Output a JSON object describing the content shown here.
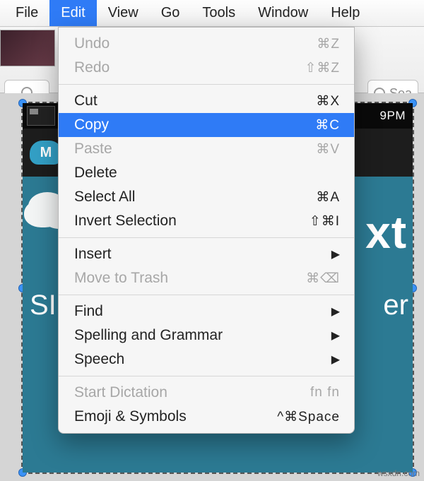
{
  "menubar": {
    "items": [
      "File",
      "Edit",
      "View",
      "Go",
      "Tools",
      "Window",
      "Help"
    ],
    "active_index": 1
  },
  "toolbar": {
    "search_placeholder": "Sea"
  },
  "dropdown": {
    "groups": [
      [
        {
          "label": "Undo",
          "shortcut": "⌘Z",
          "disabled": true
        },
        {
          "label": "Redo",
          "shortcut": "⇧⌘Z",
          "disabled": true
        }
      ],
      [
        {
          "label": "Cut",
          "shortcut": "⌘X"
        },
        {
          "label": "Copy",
          "shortcut": "⌘C",
          "selected": true
        },
        {
          "label": "Paste",
          "shortcut": "⌘V",
          "disabled": true
        },
        {
          "label": "Delete"
        },
        {
          "label": "Select All",
          "shortcut": "⌘A"
        },
        {
          "label": "Invert Selection",
          "shortcut": "⇧⌘I"
        }
      ],
      [
        {
          "label": "Insert",
          "submenu": true
        },
        {
          "label": "Move to Trash",
          "shortcut": "⌘⌫",
          "disabled": true
        }
      ],
      [
        {
          "label": "Find",
          "submenu": true
        },
        {
          "label": "Spelling and Grammar",
          "submenu": true
        },
        {
          "label": "Speech",
          "submenu": true
        }
      ],
      [
        {
          "label": "Start Dictation",
          "shortcut": "fn fn",
          "disabled": true
        },
        {
          "label": "Emoji & Symbols",
          "shortcut": "^⌘Space"
        }
      ]
    ]
  },
  "content": {
    "status_time": "9PM",
    "header_badge_text": "M",
    "big_text_fragment": "xt",
    "sub_left": "SI",
    "sub_right": "er"
  },
  "watermark": "wsxdn.com"
}
